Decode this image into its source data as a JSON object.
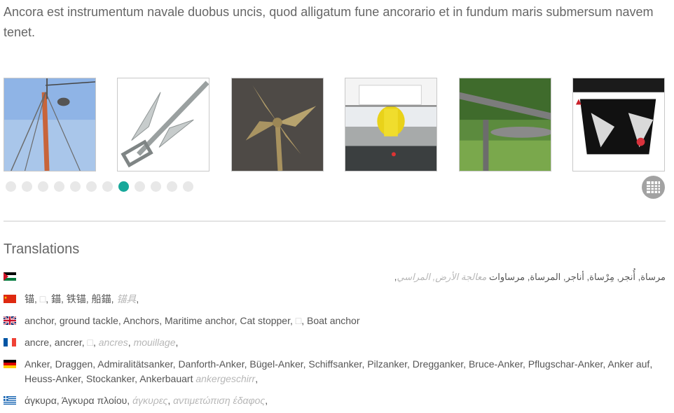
{
  "intro": {
    "text": "Ancora est instrumentum navale duobus uncis, quod alligatum fune ancorario et in fundum maris submersum navem tenet."
  },
  "gallery": {
    "slide_count": 12,
    "active_slide": 8,
    "thumbnails": [
      "mast-photo",
      "grapnel-anchor-photo",
      "folding-anchor-photo",
      "ship-deck-photo",
      "stock-anchor-photo",
      "bow-anchor-photo"
    ]
  },
  "translations": {
    "title": "Translations",
    "arabic": {
      "plain": "مرساة, أُنجر, مِرْساة, أناجر, المرساة, مرساوات",
      "muted": "معالجة الأرض, المراسي",
      "tail": ","
    },
    "chinese": {
      "p1": "锚, ",
      "box": "□",
      "p2": ", 錨, 铁锚, 船錨, ",
      "muted": "锚具",
      "tail": ","
    },
    "english": {
      "p1": "anchor, ground tackle, Anchors, Maritime anchor, Cat stopper, ",
      "box": "□",
      "p2": ", Boat anchor"
    },
    "french": {
      "p1": "ancre, ancrer, ",
      "box": "□",
      "sep": ", ",
      "muted1": "ancres",
      "sep2": ", ",
      "muted2": "mouillage",
      "tail": ","
    },
    "german": {
      "plain": "Anker, Draggen, Admiralitätsanker, Danforth-Anker, Bügel-Anker, Schiffsanker, Pilzanker, Dregganker, Bruce-Anker, Pflugschar-Anker, Anker auf, Heuss-Anker, Stockanker, Ankerbauart ",
      "muted": "ankergeschirr",
      "tail": ","
    },
    "greek": {
      "plain": "άγκυρα, Άγκυρα πλοίου, ",
      "muted1": "άγκυρες",
      "sep": ", ",
      "muted2": "αντιμετώπιση έδαφος",
      "tail": ","
    }
  },
  "colors": {
    "accent": "#17a89a",
    "dot_inactive": "#e8e8e8",
    "grid_button": "#a2a2a2"
  }
}
